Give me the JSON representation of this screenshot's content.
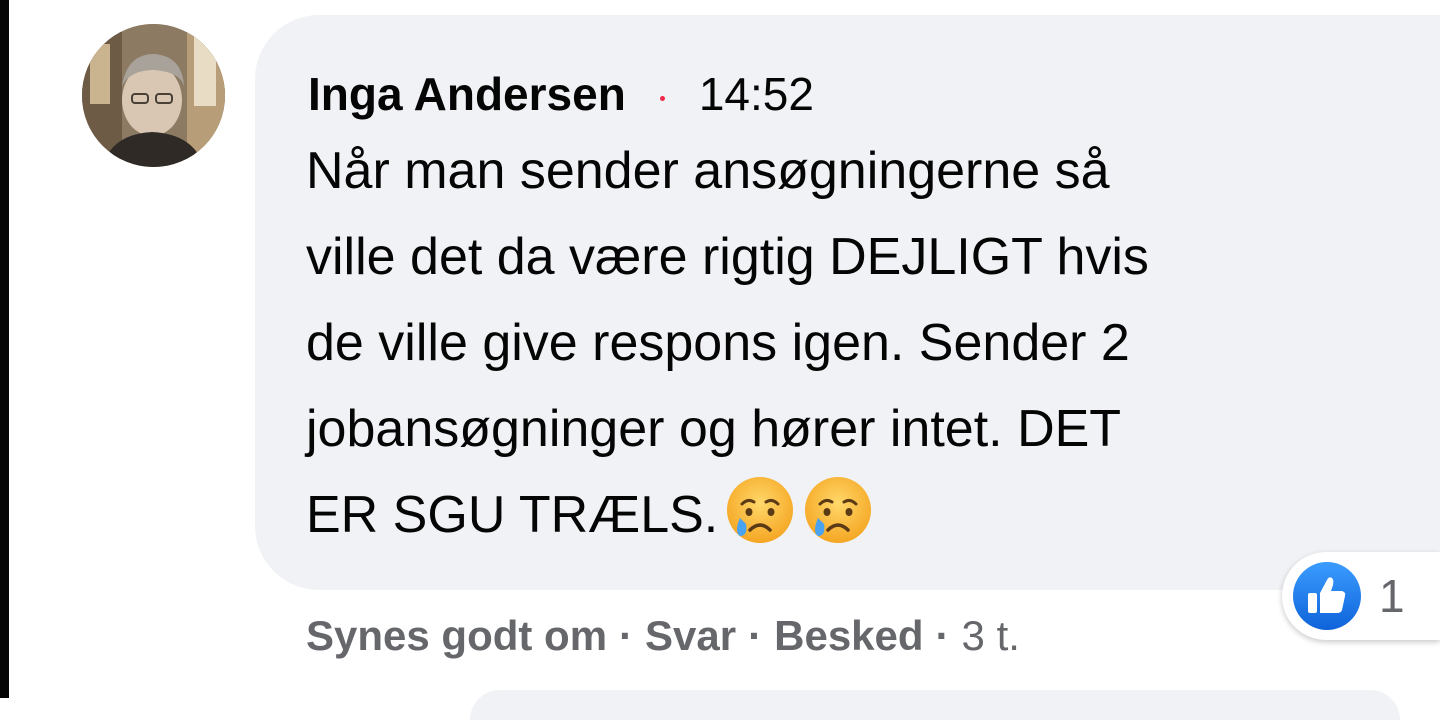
{
  "comment": {
    "author": "Inga Andersen",
    "timestamp": "14:52",
    "text_lines": [
      "Når man sender ansøgningerne så",
      "ville det da være rigtig DEJLIGT hvis",
      "de ville give respons igen. Sender 2",
      "jobansøgninger og hører intet. DET",
      "ER SGU TRÆLS."
    ],
    "emojis": [
      "crying-face",
      "crying-face"
    ],
    "reactions": {
      "icon": "like-icon",
      "count": "1",
      "color": "#1877f2"
    }
  },
  "actions": {
    "like_label": "Synes godt om",
    "separator": "·",
    "reply_label": "Svar",
    "message_label": "Besked",
    "age": "3 t."
  },
  "colors": {
    "bubble": "#f0f2f5",
    "text": "#050505",
    "secondary_text": "#65676b",
    "meta_dot": "#f0284a",
    "like_blue": "#1877f2"
  }
}
